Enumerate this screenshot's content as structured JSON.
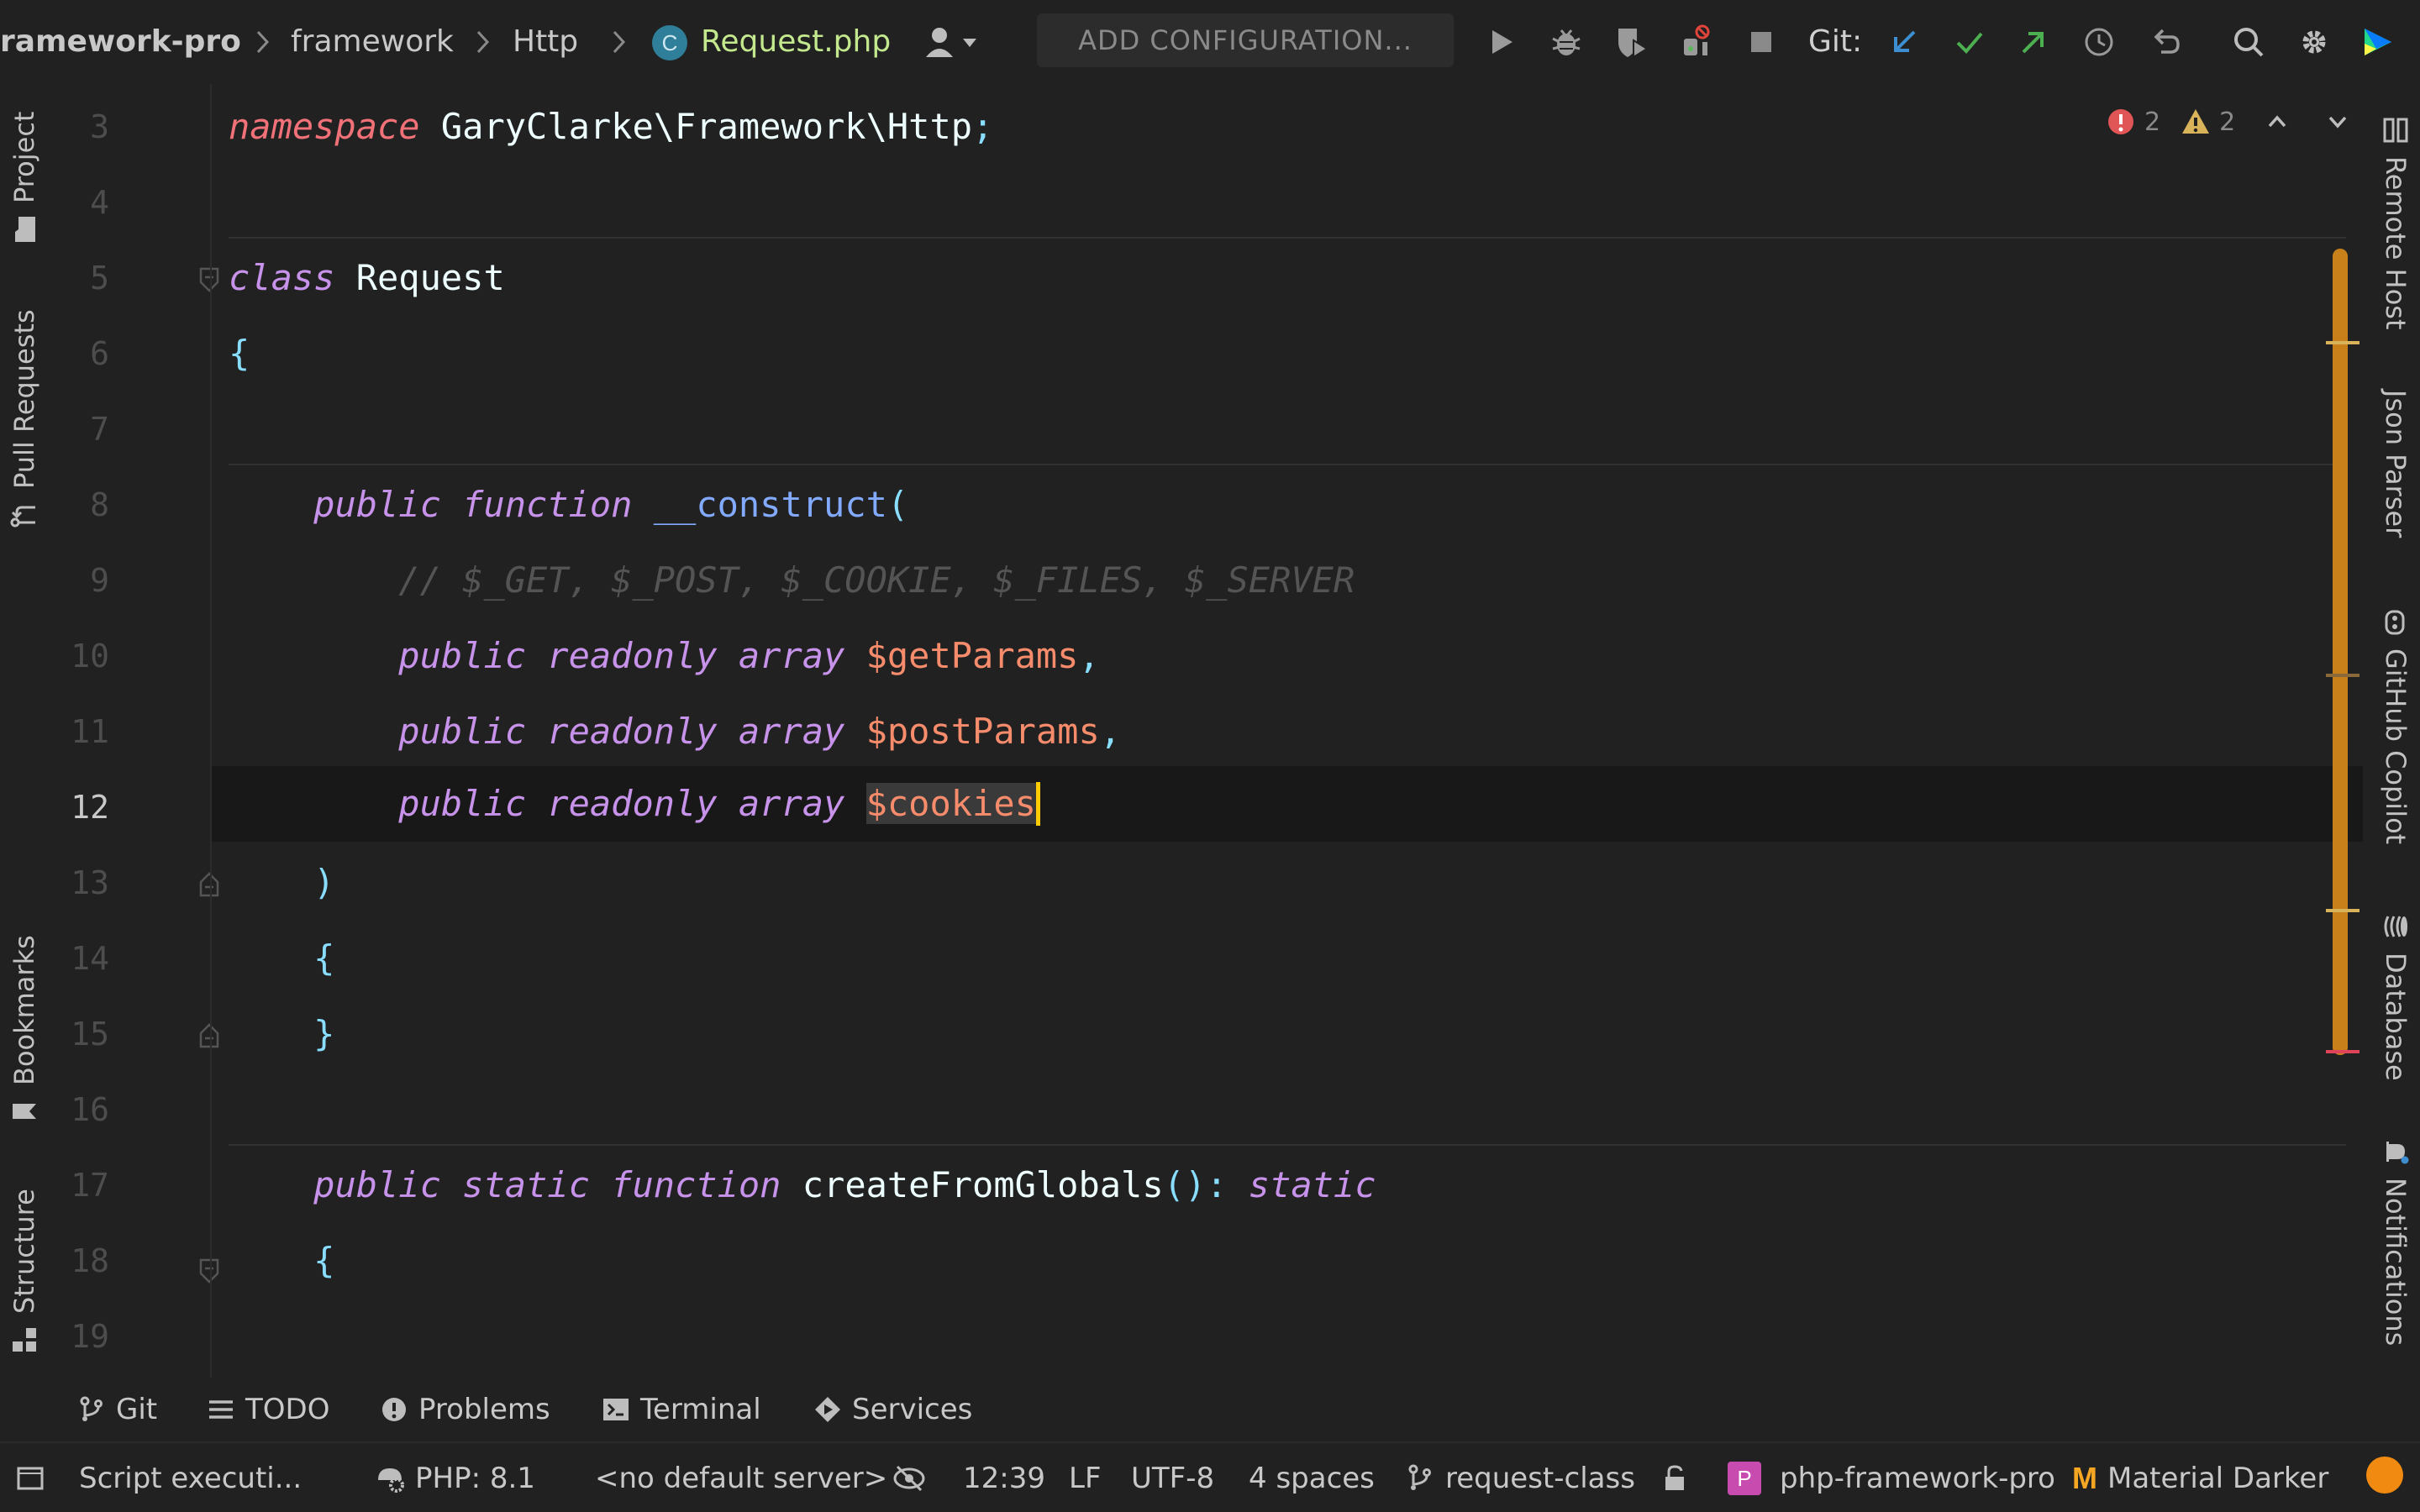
{
  "toolbar": {
    "project": "ramework-pro",
    "crumb_1": "framework",
    "crumb_2": "Http",
    "file_badge": "C",
    "file": "Request.php",
    "add_config": "ADD CONFIGURATION...",
    "git_label": "Git:"
  },
  "left_strip": {
    "project": "Project",
    "pull_requests": "Pull Requests",
    "bookmarks": "Bookmarks",
    "structure": "Structure"
  },
  "right_strip": {
    "remote_host": "Remote Host",
    "json_parser": "Json Parser",
    "copilot": "GitHub Copilot",
    "database": "Database",
    "notifications": "Notifications"
  },
  "inspections": {
    "errors": "2",
    "warnings": "2"
  },
  "editor": {
    "current_line": 12,
    "line_numbers": [
      "3",
      "4",
      "5",
      "6",
      "7",
      "8",
      "9",
      "10",
      "11",
      "12",
      "13",
      "14",
      "15",
      "16",
      "17",
      "18",
      "19"
    ],
    "lines": {
      "l3_kw": "namespace",
      "l3_ns": "GaryClarke\\Framework\\Http",
      "l3_semi": ";",
      "l5_kw": "class",
      "l5_name": "Request",
      "l6": "{",
      "l8_kw": "public function",
      "l8_fn": "__construct",
      "l8_paren": "(",
      "l9": "// $_GET, $_POST, $_COOKIE, $_FILES, $_SERVER",
      "l10_kw": "public readonly array",
      "l10_var": "$getParams",
      "l10_comma": ",",
      "l11_kw": "public readonly array",
      "l11_var": "$postParams",
      "l11_comma": ",",
      "l12_kw": "public readonly array",
      "l12_var": "$cookies",
      "l13": ")",
      "l14": "{",
      "l15": "}",
      "l17_kw": "public static function",
      "l17_fn": "createFromGlobals",
      "l17_paren": "():",
      "l17_ret": "static",
      "l18": "{"
    }
  },
  "bottom_tabs": {
    "git": "Git",
    "todo": "TODO",
    "problems": "Problems",
    "terminal": "Terminal",
    "services": "Services"
  },
  "status": {
    "script": "Script executi...",
    "php": "PHP: 8.1",
    "server": "<no default server>",
    "position": "12:39",
    "line_sep": "LF",
    "encoding": "UTF-8",
    "indent": "4 spaces",
    "branch": "request-class",
    "project_badge": "P",
    "project": "php-framework-pro",
    "theme_badge": "M",
    "theme": "Material Darker"
  },
  "colors": {
    "background": "#212121",
    "keyword": "#c792ea",
    "variable": "#f78c6c",
    "function": "#82aaff",
    "punctuation": "#89ddff",
    "comment": "#545454",
    "caret": "#ffcc00",
    "marker_bar": "#c8801a"
  }
}
